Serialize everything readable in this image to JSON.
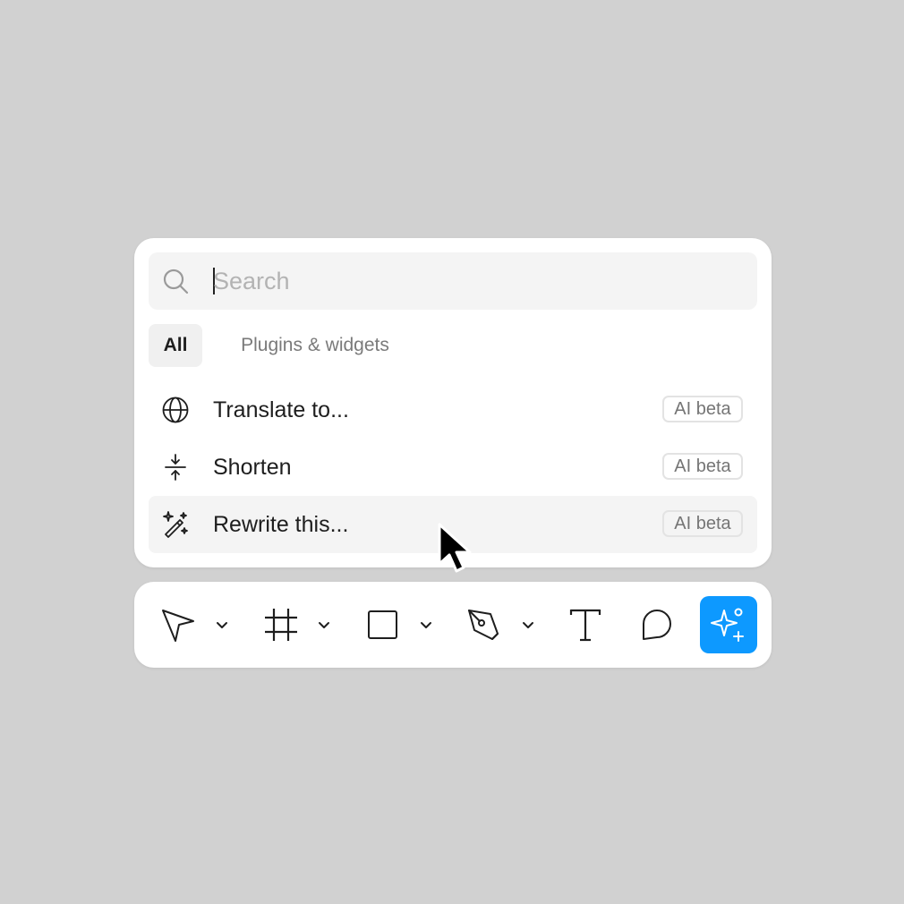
{
  "search": {
    "placeholder": "Search",
    "value": ""
  },
  "tabs": [
    {
      "label": "All",
      "selected": true
    },
    {
      "label": "Plugins & widgets",
      "selected": false
    }
  ],
  "actions": [
    {
      "label": "Translate to...",
      "badge": "AI beta",
      "icon": "globe-icon"
    },
    {
      "label": "Shorten",
      "badge": "AI beta",
      "icon": "shorten-icon"
    },
    {
      "label": "Rewrite this...",
      "badge": "AI beta",
      "icon": "magic-wand-icon",
      "hovered": true
    }
  ],
  "toolbar": {
    "tools": [
      "move-tool",
      "frame-tool",
      "rectangle-tool",
      "pen-tool",
      "text-tool",
      "comment-tool",
      "ai-actions-tool"
    ],
    "active_tool": "ai-actions-tool",
    "accent_color": "#0d99ff"
  },
  "colors": {
    "background": "#d1d1d1",
    "panel": "#ffffff",
    "highlight": "#f4f4f4"
  }
}
